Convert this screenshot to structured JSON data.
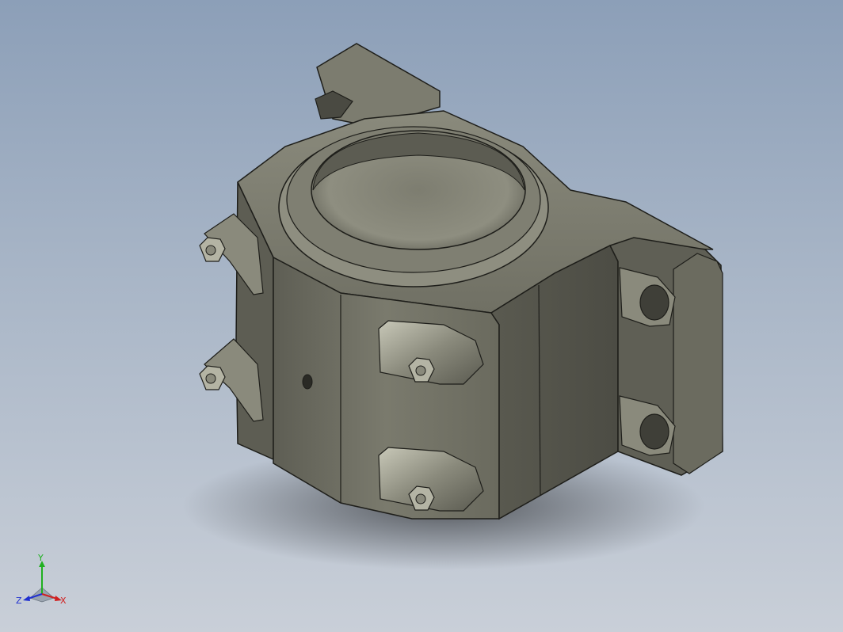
{
  "viewport": {
    "background_top": "#8c9fb8",
    "background_bottom": "#c9cfd8"
  },
  "model": {
    "part_color": "#6f6f63",
    "part_light": "#9a9a8c",
    "part_dark": "#4f4f46",
    "edge_color": "#1e1e1a"
  },
  "triad": {
    "x_label": "X",
    "y_label": "Y",
    "z_label": "Z",
    "x_color": "#d02020",
    "y_color": "#20b020",
    "z_color": "#2030d0"
  }
}
